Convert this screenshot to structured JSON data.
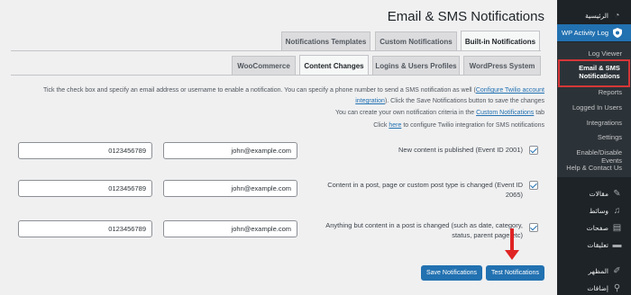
{
  "page": {
    "title": "Email & SMS Notifications"
  },
  "tabs_primary": [
    {
      "label": "Notifications Templates",
      "active": false
    },
    {
      "label": "Custom Notifications",
      "active": false
    },
    {
      "label": "Built-in Notifications",
      "active": true
    }
  ],
  "tabs_secondary": [
    {
      "label": "WooCommerce",
      "active": false
    },
    {
      "label": "Content Changes",
      "active": true
    },
    {
      "label": "Logins & Users Profiles",
      "active": false
    },
    {
      "label": "WordPress System",
      "active": false
    }
  ],
  "description": {
    "line1_text": "Tick the check box and specify an email address or username to enable a notification. You can specify a phone number to send a SMS notification as well (",
    "line1_link": "Configure Twilio account",
    "line2_link": "integration",
    "line2_text": "). Click the Save Notifications button to save the changes",
    "line3_text": "You can create your own notification criteria in the",
    "line3_link": "Custom Notifications",
    "line3_suffix": "tab",
    "line4_text": "Click",
    "line4_link": "here",
    "line4_suffix": "to configure Twilio integration for SMS notifications"
  },
  "notifications": [
    {
      "label": "New content is published (Event ID 2001)",
      "email": "john@example.com",
      "phone": "0123456789",
      "checked": true
    },
    {
      "label": "Content in a post, page or custom post type is changed (Event ID 2065)",
      "email": "john@example.com",
      "phone": "0123456789",
      "checked": true
    },
    {
      "label": "Anything but content in a post is changed (such as date, category, status, parent page etc)",
      "email": "john@example.com",
      "phone": "0123456789",
      "checked": true
    }
  ],
  "buttons": {
    "save": "Save Notifications",
    "test": "Test Notifications"
  },
  "sidebar": {
    "dashboard": "الرئيسية",
    "wpal": "WP Activity Log",
    "sub": [
      "Log Viewer",
      "Email & SMS Notifications",
      "Reports",
      "Logged In Users",
      "Integrations",
      "Settings",
      "Enable/Disable Events",
      "Help & Contact Us"
    ],
    "menu": [
      "مقالات",
      "وسائط",
      "صفحات",
      "تعليقات",
      "المظهر",
      "إضافات"
    ]
  },
  "colors": {
    "accent": "#2271b1",
    "sidebar_bg": "#1d2327",
    "highlight": "#d63638",
    "annotation_arrow": "#e02424"
  }
}
